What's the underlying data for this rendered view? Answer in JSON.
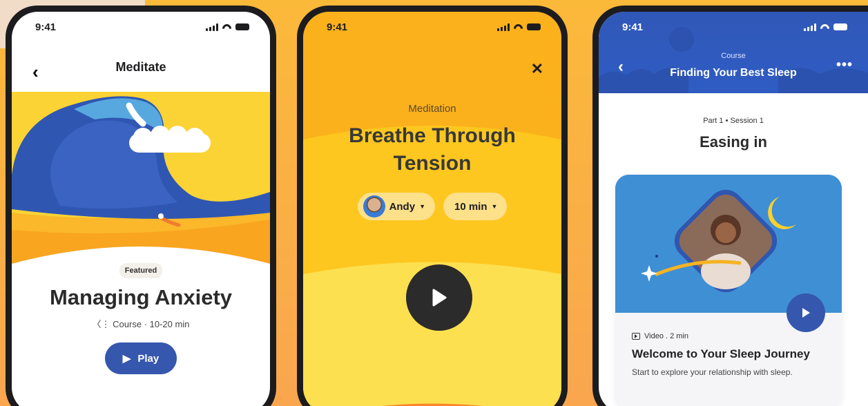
{
  "screen1": {
    "time": "9:41",
    "title": "Meditate",
    "badge": "Featured",
    "name": "Managing Anxiety",
    "meta": "Course · 10-20 min",
    "play_label": "Play"
  },
  "screen2": {
    "time": "9:41",
    "label": "Meditation",
    "title": "Breathe Through Tension",
    "teacher": "Andy",
    "duration": "10 min"
  },
  "screen3": {
    "time": "9:41",
    "kind": "Course",
    "course_title": "Finding Your Best Sleep",
    "part": "Part 1 • Session 1",
    "session_title": "Easing in",
    "video_meta": "Video . 2 min",
    "video_title": "Welcome to Your Sleep Journey",
    "video_desc": "Start to explore your relationship with sleep."
  },
  "colors": {
    "yellow": "#fcb920",
    "blue": "#3557ad",
    "sky": "#3f8fd4",
    "dark": "#2b2b2b"
  },
  "icons": [
    "back-arrow-icon",
    "close-icon",
    "more-icon",
    "play-icon",
    "speaker-icon",
    "video-icon",
    "signal-icon",
    "wifi-icon",
    "battery-icon"
  ]
}
